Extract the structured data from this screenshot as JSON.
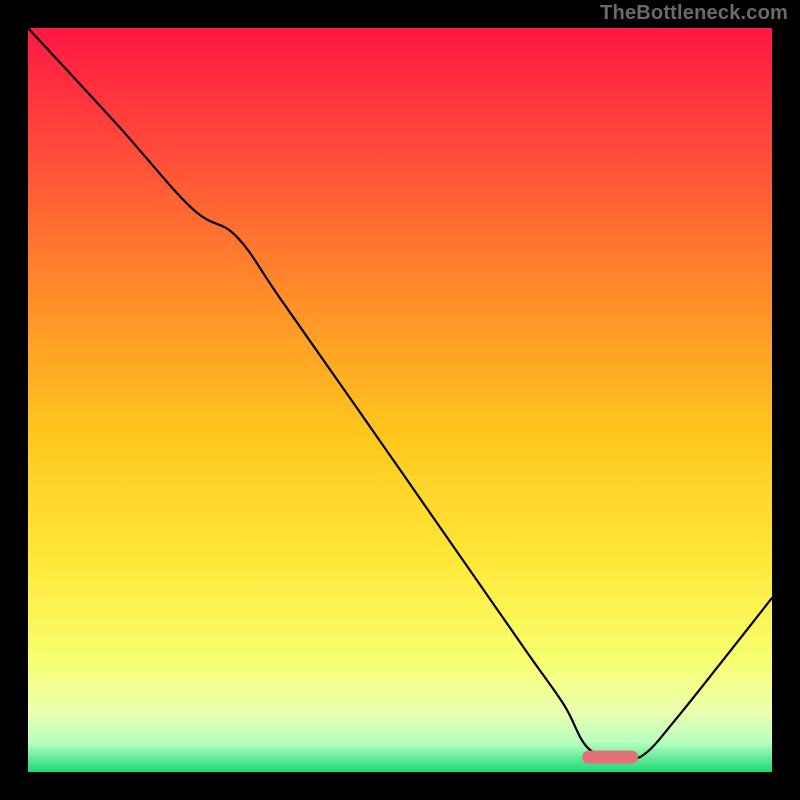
{
  "watermark": "TheBottleneck.com",
  "chart_data": {
    "type": "line",
    "title": "",
    "xlabel": "",
    "ylabel": "",
    "xlim": [
      0,
      1
    ],
    "ylim": [
      0,
      1
    ],
    "note": "Plot has no visible axis ticks or numeric labels; values are normalized 0–1 estimates read off the image geometry (x: left→right, y: bottom→top).",
    "series": [
      {
        "name": "black-curve",
        "x": [
          0.0,
          0.12,
          0.22,
          0.28,
          0.34,
          0.45,
          0.56,
          0.67,
          0.72,
          0.755,
          0.805,
          0.83,
          0.87,
          0.93,
          1.0
        ],
        "y": [
          1.0,
          0.87,
          0.758,
          0.72,
          0.635,
          0.478,
          0.32,
          0.162,
          0.091,
          0.03,
          0.02,
          0.025,
          0.07,
          0.145,
          0.234
        ]
      }
    ],
    "marker": {
      "name": "pink-bar",
      "x_start": 0.745,
      "x_end": 0.82,
      "y": 0.02,
      "color": "#e4717a"
    },
    "background_gradient": {
      "type": "vertical",
      "stops": [
        {
          "offset": 0.0,
          "color": "#ff1744"
        },
        {
          "offset": 0.17,
          "color": "#ff4d3a"
        },
        {
          "offset": 0.35,
          "color": "#ff8a2a"
        },
        {
          "offset": 0.55,
          "color": "#ffc81e"
        },
        {
          "offset": 0.72,
          "color": "#ffe93b"
        },
        {
          "offset": 0.85,
          "color": "#f8ff70"
        },
        {
          "offset": 0.92,
          "color": "#eaffb0"
        },
        {
          "offset": 0.96,
          "color": "#b8ffc0"
        },
        {
          "offset": 1.0,
          "color": "#1bd978"
        }
      ]
    }
  }
}
